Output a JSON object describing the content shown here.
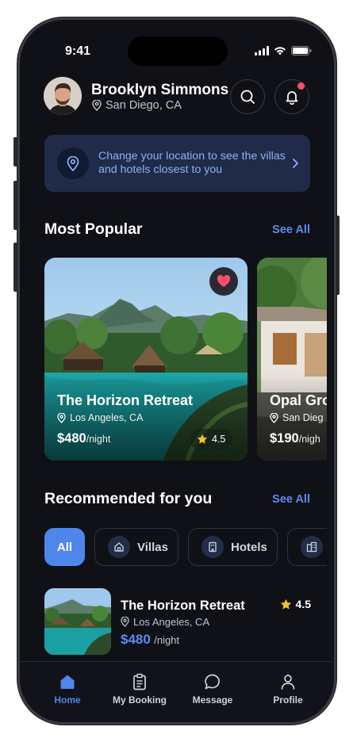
{
  "status": {
    "time": "9:41"
  },
  "user": {
    "name": "Brooklyn Simmons",
    "location": "San Diego, CA"
  },
  "banner": {
    "text": "Change your location to see the villas and hotels closest to you"
  },
  "most_popular": {
    "title": "Most Popular",
    "see_all": "See All",
    "cards": [
      {
        "name": "The Horizon Retreat",
        "location": "Los Angeles, CA",
        "price": "$480",
        "per": "/night",
        "rating": "4.5",
        "favorite": true
      },
      {
        "name": "Opal Gro",
        "location": "San Dieg",
        "price": "$190",
        "per": "/nigh"
      }
    ]
  },
  "recommended": {
    "title": "Recommended for you",
    "see_all": "See All",
    "filters": [
      {
        "label": "All",
        "active": true
      },
      {
        "label": "Villas",
        "icon": "house-icon"
      },
      {
        "label": "Hotels",
        "icon": "building-icon"
      },
      {
        "label": "",
        "icon": "apartment-icon"
      }
    ],
    "items": [
      {
        "name": "The Horizon Retreat",
        "location": "Los Angeles, CA",
        "price": "$480",
        "per": "/night",
        "rating": "4.5"
      }
    ]
  },
  "nav": [
    {
      "label": "Home",
      "icon": "home-icon",
      "active": true
    },
    {
      "label": "My Booking",
      "icon": "clipboard-icon"
    },
    {
      "label": "Message",
      "icon": "chat-icon"
    },
    {
      "label": "Profile",
      "icon": "person-icon"
    }
  ],
  "colors": {
    "accent": "#4f86eb",
    "background": "#101117",
    "banner": "#1f2b48",
    "notification": "#ff4d6d",
    "star": "#f7c325"
  }
}
